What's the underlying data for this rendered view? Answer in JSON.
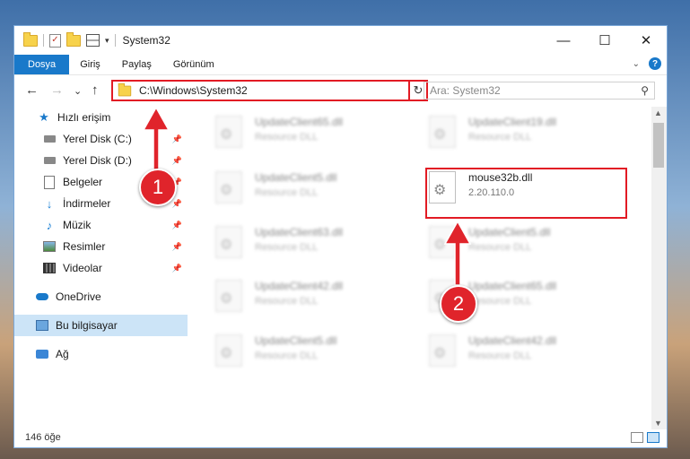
{
  "window": {
    "title": "System32"
  },
  "window_controls": {
    "minimize": "—",
    "maximize": "☐",
    "close": "✕"
  },
  "ribbon": {
    "tabs": [
      "Dosya",
      "Giriş",
      "Paylaş",
      "Görünüm"
    ],
    "chevron": "⌄",
    "help": "?"
  },
  "nav": {
    "back": "←",
    "forward": "→",
    "recent": "⌄",
    "up": "↑"
  },
  "address": {
    "path": "C:\\Windows\\System32",
    "dropdown": "⌄",
    "refresh": "↻"
  },
  "search": {
    "placeholder": "Ara: System32",
    "icon": "⚲"
  },
  "sidebar": {
    "items": [
      {
        "label": "Hızlı erişim",
        "icon": "star-icon"
      },
      {
        "label": "Yerel Disk (C:)",
        "icon": "drive-icon",
        "pinned": true
      },
      {
        "label": "Yerel Disk (D:)",
        "icon": "drive-icon",
        "pinned": true
      },
      {
        "label": "Belgeler",
        "icon": "document-icon",
        "pinned": true
      },
      {
        "label": "İndirmeler",
        "icon": "download-icon",
        "pinned": true
      },
      {
        "label": "Müzik",
        "icon": "music-icon",
        "pinned": true
      },
      {
        "label": "Resimler",
        "icon": "pictures-icon",
        "pinned": true
      },
      {
        "label": "Videolar",
        "icon": "videos-icon",
        "pinned": true
      },
      {
        "label": "OneDrive",
        "icon": "cloud-icon"
      },
      {
        "label": "Bu bilgisayar",
        "icon": "computer-icon",
        "selected": true
      },
      {
        "label": "Ağ",
        "icon": "network-icon"
      }
    ],
    "pin_glyph": "📌"
  },
  "files": {
    "left": [
      {
        "name": "UpdateClient65.dll",
        "sub": "Resource DLL"
      },
      {
        "name": "UpdateClient5.dll",
        "sub": "Resource DLL"
      },
      {
        "name": "UpdateClient63.dll",
        "sub": "Resource DLL"
      },
      {
        "name": "UpdateClient42.dll",
        "sub": "Resource DLL"
      },
      {
        "name": "UpdateClient5.dll",
        "sub": "Resource DLL"
      }
    ],
    "right": [
      {
        "name": "UpdateClient19.dll",
        "sub": "Resource DLL"
      },
      {
        "name": "mouse32b.dll",
        "sub": "2.20.110.0",
        "highlight": true
      },
      {
        "name": "UpdateClient5.dll",
        "sub": "Resource DLL"
      },
      {
        "name": "UpdateClient65.dll",
        "sub": "Resource DLL"
      },
      {
        "name": "UpdateClient42.dll",
        "sub": "Resource DLL"
      }
    ]
  },
  "status": {
    "count": "146 öğe"
  },
  "callouts": {
    "one": "1",
    "two": "2"
  },
  "colors": {
    "accent": "#1979ca",
    "callout": "#e0242b"
  }
}
